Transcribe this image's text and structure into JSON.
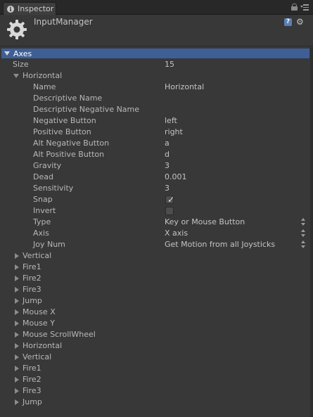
{
  "tab": {
    "label": "Inspector",
    "icon": "info-icon"
  },
  "header": {
    "title": "InputManager",
    "icon": "gear-icon"
  },
  "axes": {
    "label": "Axes",
    "size_label": "Size",
    "size_value": "15",
    "expanded_axis": {
      "label": "Horizontal",
      "fields": [
        {
          "label": "Name",
          "value": "Horizontal"
        },
        {
          "label": "Descriptive Name",
          "value": ""
        },
        {
          "label": "Descriptive Negative Name",
          "value": ""
        },
        {
          "label": "Negative Button",
          "value": "left"
        },
        {
          "label": "Positive Button",
          "value": "right"
        },
        {
          "label": "Alt Negative Button",
          "value": "a"
        },
        {
          "label": "Alt Positive Button",
          "value": "d"
        },
        {
          "label": "Gravity",
          "value": "3"
        },
        {
          "label": "Dead",
          "value": "0.001"
        },
        {
          "label": "Sensitivity",
          "value": "3"
        },
        {
          "label": "Snap",
          "checked": true
        },
        {
          "label": "Invert",
          "checked": false
        },
        {
          "label": "Type",
          "value": "Key or Mouse Button"
        },
        {
          "label": "Axis",
          "value": "X axis"
        },
        {
          "label": "Joy Num",
          "value": "Get Motion from all Joysticks"
        }
      ]
    },
    "collapsed_axes": [
      "Vertical",
      "Fire1",
      "Fire2",
      "Fire3",
      "Jump",
      "Mouse X",
      "Mouse Y",
      "Mouse ScrollWheel",
      "Horizontal",
      "Vertical",
      "Fire1",
      "Fire2",
      "Fire3",
      "Jump"
    ]
  },
  "colors": {
    "background": "#383838",
    "selection": "#3e5f96",
    "text": "#b8b8b8"
  }
}
